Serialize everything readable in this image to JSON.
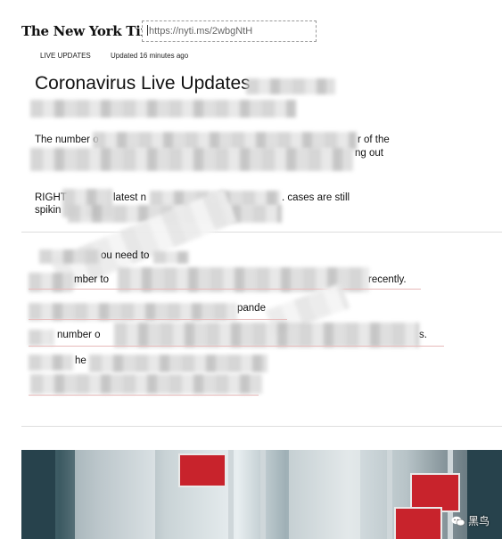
{
  "header": {
    "masthead": "The New York Times",
    "url_value": "https://nyti.ms/2wbgNtH"
  },
  "meta": {
    "live_label": "LIVE UPDATES",
    "updated_label": "Updated 16 minutes ago"
  },
  "article": {
    "title": "Coronavirus Live Updates",
    "para1_line1_start": "The number o",
    "para1_line1_end": "r of the",
    "para1_line2_end": "ng out",
    "para2_line1_start": "RIGHT",
    "para2_line1_mid": "latest n",
    "para2_line1_end": ". cases are still",
    "para2_line2_start": "spikin"
  },
  "section": {
    "heading_fragment": "ou need to",
    "item1_start": "mber to",
    "item1_end": "recently.",
    "item2_fragment": "pande",
    "item3_start": "number o",
    "item3_end": "s.",
    "item4_fragment": "he"
  },
  "watermark": {
    "text": "黑鸟"
  },
  "colors": {
    "sign_red": "#c8232c",
    "link_underline": "#e7b9b9"
  }
}
